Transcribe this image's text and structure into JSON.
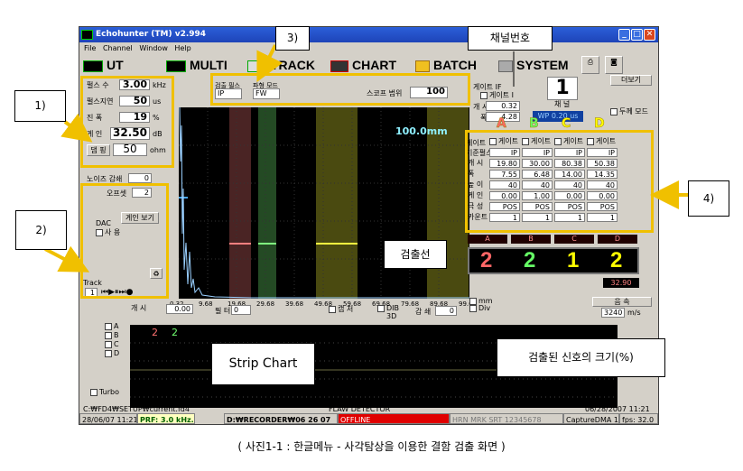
{
  "window": {
    "title": "Echohunter (TM) v2.994"
  },
  "menu": [
    "File",
    "Channel",
    "Window",
    "Help"
  ],
  "toolbar": {
    "ut": "UT",
    "multi": "MULTI",
    "track": "TRACK",
    "chart": "CHART",
    "batch": "BATCH",
    "system": "SYSTEM"
  },
  "left_params": {
    "pulse_label": "펄스 수",
    "pulse_value": "3.00",
    "pulse_unit": "kHz",
    "delay_label": "펄스지연",
    "delay_value": "50",
    "delay_unit": "us",
    "amp_label": "진   폭",
    "amp_value": "19",
    "amp_unit": "%",
    "gain_label": "게  인",
    "gain_value": "32.50",
    "gain_unit": "dB",
    "damp_label": "댐 핑",
    "damp_value": "50",
    "damp_unit": "ohm",
    "noise_label": "노이즈 감쇄",
    "noise_value": "0",
    "offset_label": "오프셋",
    "offset_value": "2",
    "gain_view_btn": "게인 보기",
    "dac_label": "DAC",
    "dac_use": "사 용",
    "track_label": "Track",
    "track_value": "1"
  },
  "mode_row": {
    "filter_label": "검출 필스",
    "filter_value": "IP",
    "wave_label": "파형 모드",
    "wave_value": "FW",
    "scope_label": "스코프 범위",
    "scope_value": "100"
  },
  "gate_if": {
    "label": "게이트 IF",
    "gate_check": "게이트 I",
    "start_label": "개 시",
    "start_value": "0.32",
    "width_label": "폭",
    "width_value": "4.28",
    "channel_label": "채 널",
    "channel_value": "1",
    "detail_btn": "더보기",
    "thick_mode": "두께 모드",
    "wp_label": "WP  0.20 us"
  },
  "ascan": {
    "range_text": "100.0mm",
    "detect_line": "검출선",
    "ticks": [
      "0.32",
      "9.68",
      "19.68",
      "29.68",
      "39.68",
      "49.68",
      "59.68",
      "69.68",
      "79.68",
      "89.68",
      "99.68"
    ]
  },
  "ascan_ctrl": {
    "start_label": "개 시",
    "start_value": "0.00",
    "filter_label": "필 터",
    "filter_value": "0",
    "capture": "캡 처",
    "dib": "DIB",
    "three_d": "3D",
    "attenuate_label": "감 쇄",
    "attenuate_value": "0",
    "mm": "mm",
    "div": "Div",
    "velocity_btn": "음 속",
    "velocity_value": "3240",
    "velocity_unit": "m/s"
  },
  "gates": {
    "header_label": "게이트",
    "ref_label": "기준펄스",
    "rows": [
      {
        "label": "개 시",
        "values": [
          "19.80",
          "30.00",
          "80.38",
          "50.38"
        ]
      },
      {
        "label": "폭",
        "values": [
          "7.55",
          "6.48",
          "14.00",
          "14.35"
        ]
      },
      {
        "label": "높 이",
        "values": [
          "40",
          "40",
          "40",
          "40"
        ]
      },
      {
        "label": "게 인",
        "values": [
          "0.00",
          "1.00",
          "0.00",
          "0.00"
        ]
      },
      {
        "label": "극 성",
        "values": [
          "POS",
          "POS",
          "POS",
          "POS"
        ]
      },
      {
        "label": "카운트",
        "values": [
          "1",
          "1",
          "1",
          "1"
        ]
      }
    ],
    "columns": [
      {
        "letter": "A",
        "check": "게이트",
        "ref": "IP",
        "color": "#ff6666"
      },
      {
        "letter": "B",
        "check": "게이트",
        "ref": "IP",
        "color": "#66ff66"
      },
      {
        "letter": "C",
        "check": "게이트",
        "ref": "IP",
        "color": "#ffff00"
      },
      {
        "letter": "D",
        "check": "게이트",
        "ref": "IP",
        "color": "#ffff00"
      }
    ],
    "counts": [
      "2",
      "2",
      "1",
      "2"
    ],
    "extra_value": "32.90"
  },
  "strip": {
    "title": "Strip Chart",
    "signal_label": "검출된 신호의 크기(%)",
    "checks": [
      "A",
      "B",
      "C",
      "D"
    ],
    "val_a": "2",
    "val_b": "2",
    "turbo": "Turbo"
  },
  "status": {
    "path": "C:₩FD4₩SETUP₩current.fd4",
    "device": "FLAW DETECTOR",
    "datetime": "06/28/2007 11:21",
    "clock": "28/06/07 11:21",
    "prf": "PRF: 3.0 kHz.",
    "recorder": "D:₩RECORDER₩06 26 07",
    "offline": "OFFLINE",
    "hrn": "HRN MRK SRT 12345678",
    "capture": "CaptureDMA 1",
    "fps": "fps: 32.0"
  },
  "annotations": {
    "a1": "1)",
    "a2": "2)",
    "a3": "3)",
    "a4": "4)",
    "channel_no": "채널번호"
  },
  "caption": "( 사진1-1 : 한글메뉴 - 사각탐상을 이용한 결함 검출 화면 )"
}
